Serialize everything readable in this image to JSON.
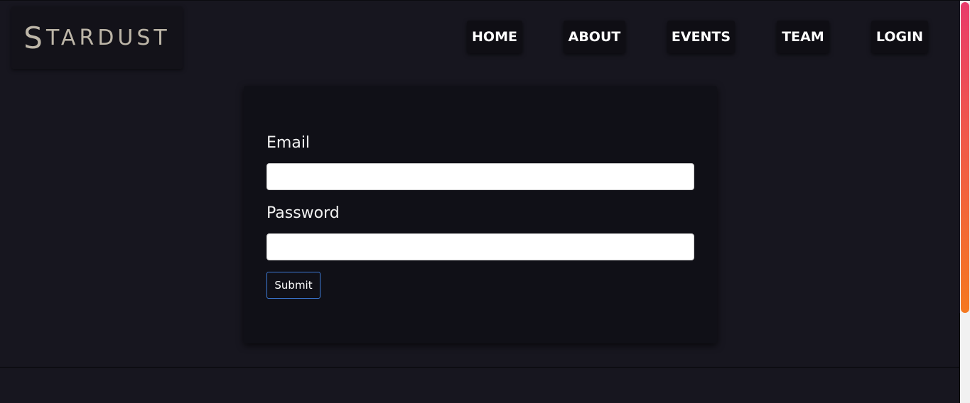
{
  "brand": {
    "first_letter": "S",
    "rest": "TARDUST",
    "color": "#bdb6a8"
  },
  "nav": {
    "home": "HOME",
    "about": "ABOUT",
    "events": "EVENTS",
    "team": "TEAM",
    "login": "LOGIN"
  },
  "login_form": {
    "email_label": "Email",
    "email_value": "",
    "password_label": "Password",
    "password_value": "",
    "submit_label": "Submit"
  },
  "colors": {
    "page_background": "#17161f",
    "card_background": "#101017",
    "submit_border": "#3d7ad6",
    "scrollbar_gradient_top": "#e83a6a",
    "scrollbar_gradient_bottom": "#f5781f"
  }
}
